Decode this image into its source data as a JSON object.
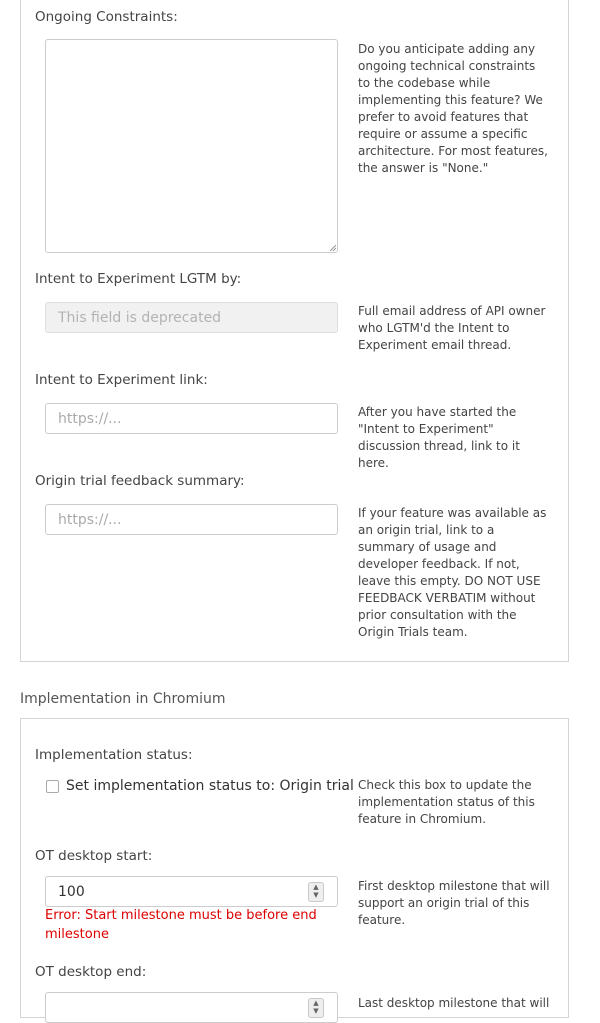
{
  "origin_trial_section": {
    "ongoing_constraints": {
      "label": "Ongoing Constraints:",
      "value": "",
      "help": "Do you anticipate adding any ongoing technical constraints to the codebase while implementing this feature? We prefer to avoid features that require or assume a specific architecture. For most features, the answer is \"None.\""
    },
    "i2e_lgtm": {
      "label": "Intent to Experiment LGTM by:",
      "placeholder": "This field is deprecated",
      "help": "Full email address of API owner who LGTM'd the Intent to Experiment email thread."
    },
    "i2e_link": {
      "label": "Intent to Experiment link:",
      "placeholder": "https://...",
      "help": "After you have started the \"Intent to Experiment\" discussion thread, link to it here."
    },
    "ot_feedback": {
      "label": "Origin trial feedback summary:",
      "placeholder": "https://...",
      "help": "If your feature was available as an origin trial, link to a summary of usage and developer feedback. If not, leave this empty. DO NOT USE FEEDBACK VERBATIM without prior consultation with the Origin Trials team."
    }
  },
  "implementation_section": {
    "title": "Implementation in Chromium",
    "impl_status": {
      "label": "Implementation status:",
      "checkbox_label": "Set implementation status to: Origin trial",
      "checked": false,
      "help": "Check this box to update the implementation status of this feature in Chromium."
    },
    "ot_desktop_start": {
      "label": "OT desktop start:",
      "value": "100",
      "help": "First desktop milestone that will support an origin trial of this feature.",
      "error_prefix": "Error",
      "error_message": ": Start milestone must be before end milestone"
    },
    "ot_desktop_end": {
      "label": "OT desktop end:",
      "help": "Last desktop milestone that will"
    }
  },
  "colors": {
    "border": "#d4d4d4",
    "error": "#dd0000",
    "disabled_bg": "#f1f1f1"
  }
}
